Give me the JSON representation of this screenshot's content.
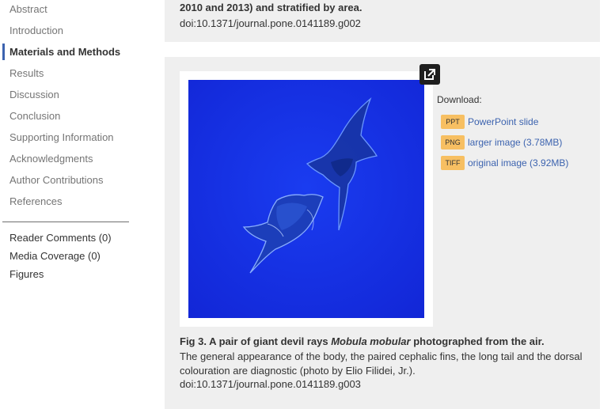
{
  "nav": {
    "items": [
      {
        "label": "Abstract",
        "active": false
      },
      {
        "label": "Introduction",
        "active": false
      },
      {
        "label": "Materials and Methods",
        "active": true
      },
      {
        "label": "Results",
        "active": false
      },
      {
        "label": "Discussion",
        "active": false
      },
      {
        "label": "Conclusion",
        "active": false
      },
      {
        "label": "Supporting Information",
        "active": false
      },
      {
        "label": "Acknowledgments",
        "active": false
      },
      {
        "label": "Author Contributions",
        "active": false
      },
      {
        "label": "References",
        "active": false
      }
    ],
    "links": [
      {
        "label": "Reader Comments (0)"
      },
      {
        "label": "Media Coverage (0)"
      },
      {
        "label": "Figures"
      }
    ]
  },
  "prev_figure": {
    "caption_tail": "2010 and 2013) and stratified by area.",
    "doi": "doi:10.1371/journal.pone.0141189.g002"
  },
  "figure": {
    "expand_icon": "external-link-icon",
    "download_label": "Download:",
    "downloads": [
      {
        "badge": "PPT",
        "label": "PowerPoint slide"
      },
      {
        "badge": "PNG",
        "label": "larger image (3.78MB)"
      },
      {
        "badge": "TIFF",
        "label": "original image (3.92MB)"
      }
    ],
    "title_prefix": "Fig 3. A pair of giant devil rays ",
    "title_species": "Mobula mobular",
    "title_suffix": " photographed from the air.",
    "description": "The general appearance of the body, the paired cephalic fins, the long tail and the dorsal colouration are diagnostic (photo by Elio Filidei, Jr.).",
    "doi": "doi:10.1371/journal.pone.0141189.g003"
  },
  "colors": {
    "link": "#3c63af",
    "badge": "#f7bf62",
    "panel": "#efefef",
    "sea": "#1730e0"
  }
}
